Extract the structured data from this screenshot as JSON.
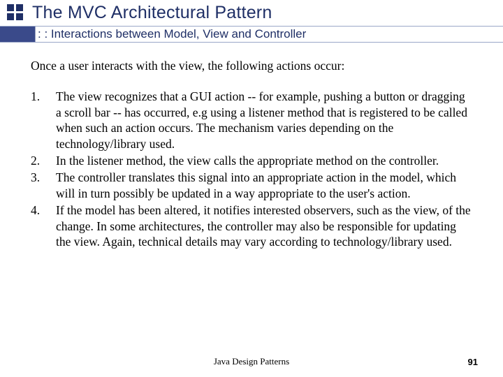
{
  "header": {
    "title": "The MVC Architectural Pattern",
    "subtitle": ": : Interactions between Model, View and Controller"
  },
  "content": {
    "intro": "Once a user interacts with the view, the following actions occur:",
    "steps": [
      "The view recognizes that a GUI action -- for example, pushing a button or dragging a scroll bar -- has occurred, e.g using a listener method that is registered to be called when such an action occurs. The mechanism varies depending on the technology/library used.",
      "In the listener method, the view calls the appropriate method on the controller.",
      "The controller translates this signal into an appropriate action in the model, which will in turn possibly be updated in a way appropriate to the user's action.",
      "If the model has been altered, it notifies interested observers, such as the view, of the change. In some architectures, the controller may also be responsible for updating the view. Again, technical details may vary according to technology/library used."
    ]
  },
  "footer": {
    "center": "Java Design Patterns",
    "page": "91"
  }
}
